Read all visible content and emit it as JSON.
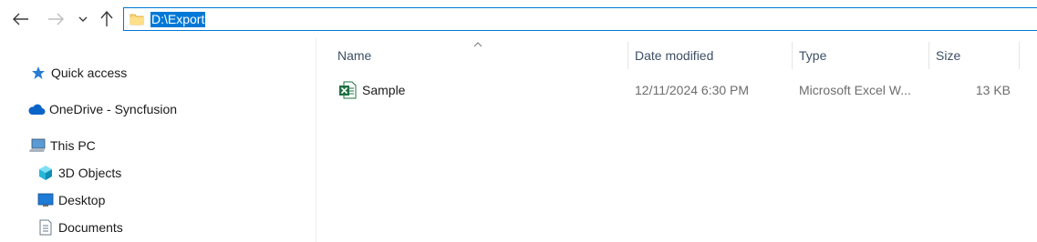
{
  "address_bar": {
    "path": "D:\\Export"
  },
  "nav": {
    "quick_access": "Quick access",
    "onedrive": "OneDrive - Syncfusion",
    "this_pc": "This PC",
    "objects3d": "3D Objects",
    "desktop": "Desktop",
    "documents": "Documents"
  },
  "columns": {
    "name": "Name",
    "date": "Date modified",
    "type": "Type",
    "size": "Size"
  },
  "files": [
    {
      "name": "Sample",
      "date": "12/11/2024 6:30 PM",
      "type": "Microsoft Excel W...",
      "size": "13 KB",
      "icon": "excel-file-icon"
    }
  ],
  "colors": {
    "accent": "#0078d7",
    "header_text": "#3d4f66",
    "excel_green": "#1f7244"
  }
}
